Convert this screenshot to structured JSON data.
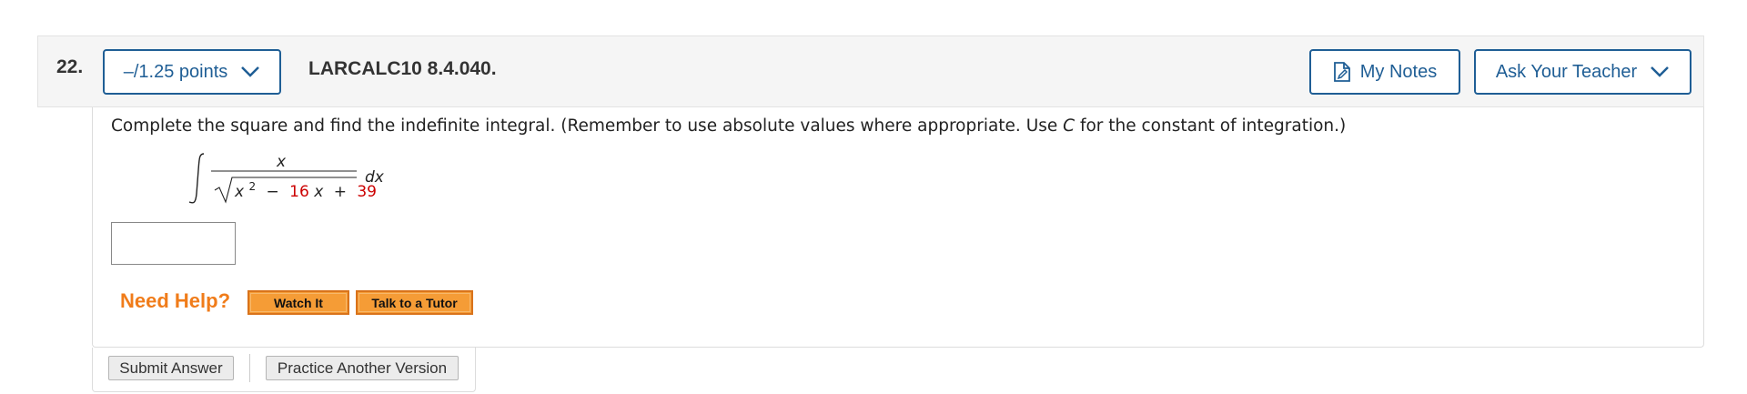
{
  "question": {
    "number": "22.",
    "points_label": "–/1.25 points",
    "id": "LARCALC10 8.4.040."
  },
  "toolbar": {
    "my_notes_label": "My Notes",
    "ask_teacher_label": "Ask Your Teacher"
  },
  "problem": {
    "prompt_before": "Complete the square and find the indefinite integral. (Remember to use absolute values where appropriate. Use ",
    "prompt_var": "C",
    "prompt_after": " for the constant of integration.)",
    "integral": {
      "numerator": "x",
      "radicand_var": "x",
      "exponent": "2",
      "minus": "−",
      "coef": "16",
      "term_var": "x",
      "plus": "+",
      "constant": "39",
      "differential": "dx"
    },
    "answer_value": ""
  },
  "help": {
    "need_help_label": "Need Help?",
    "watch_label": "Watch It",
    "tutor_label": "Talk to a Tutor"
  },
  "footer": {
    "submit_label": "Submit Answer",
    "practice_label": "Practice Another Version"
  },
  "colors": {
    "accent_blue": "#1f5e95",
    "highlight_red": "#cc0000",
    "help_orange": "#f07c1a",
    "button_orange": "#f59c36"
  }
}
